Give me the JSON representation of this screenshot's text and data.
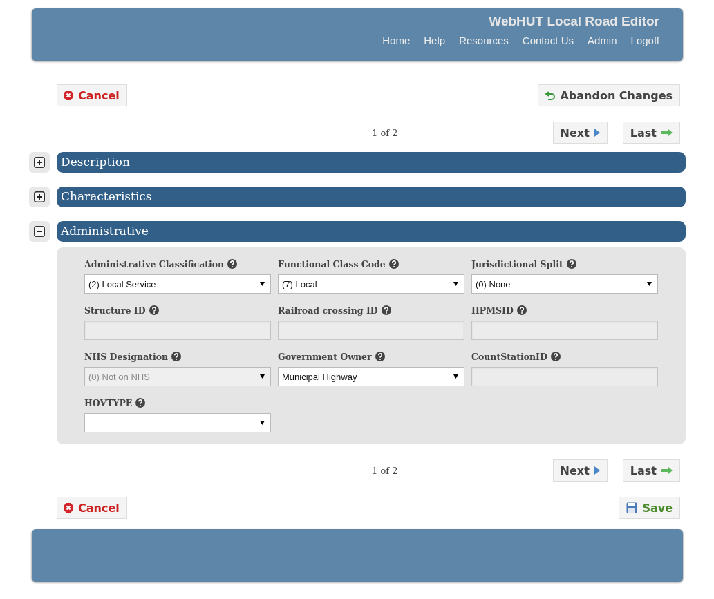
{
  "header": {
    "title": "WebHUT Local Road Editor",
    "nav": [
      "Home",
      "Help",
      "Resources",
      "Contact Us",
      "Admin",
      "Logoff"
    ]
  },
  "top_actions": {
    "cancel": "Cancel",
    "abandon": "Abandon Changes"
  },
  "pager_top": {
    "page": "1 of 2",
    "next": "Next",
    "last": "Last"
  },
  "sections": [
    {
      "title": "Description",
      "expanded": false
    },
    {
      "title": "Characteristics",
      "expanded": false
    },
    {
      "title": "Administrative",
      "expanded": true,
      "fields": [
        {
          "label": "Administrative Classification",
          "kind": "select",
          "value": "(2) Local Service",
          "disabled": false
        },
        {
          "label": "Functional Class Code",
          "kind": "select",
          "value": "(7) Local",
          "disabled": false
        },
        {
          "label": "Jurisdictional Split",
          "kind": "select",
          "value": "(0) None",
          "disabled": false
        },
        {
          "label": "Structure ID",
          "kind": "text",
          "disabled": true
        },
        {
          "label": "Railroad crossing ID",
          "kind": "text",
          "disabled": true
        },
        {
          "label": "HPMSID",
          "kind": "text",
          "disabled": true
        },
        {
          "label": "NHS Designation",
          "kind": "select",
          "value": "(0) Not on NHS",
          "disabled": true
        },
        {
          "label": "Government Owner",
          "kind": "select",
          "value": "Municipal Highway",
          "disabled": false
        },
        {
          "label": "CountStationID",
          "kind": "text",
          "disabled": true
        },
        {
          "label": "HOVTYPE",
          "kind": "select",
          "disabled": false
        }
      ]
    }
  ],
  "pager_bottom": {
    "page": "1 of 2",
    "next": "Next",
    "last": "Last"
  },
  "bottom_actions": {
    "cancel": "Cancel",
    "save": "Save"
  }
}
